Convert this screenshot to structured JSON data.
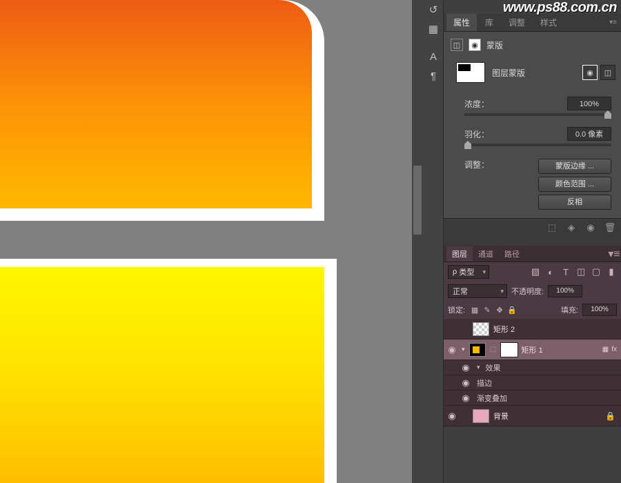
{
  "watermark": "www.ps88.com.cn",
  "toolbar": {
    "text_icon": "A",
    "pilcrow_icon": "¶"
  },
  "properties_panel": {
    "tabs": [
      "属性",
      "库",
      "调整",
      "样式"
    ],
    "title": "蒙版",
    "mask_type_label": "图层蒙版",
    "density_label": "浓度：",
    "density_value": "100%",
    "feather_label": "羽化：",
    "feather_value": "0.0 像素",
    "adjust_label": "调整：",
    "buttons": {
      "mask_edge": "蒙版边缘 ...",
      "color_range": "颜色范围 ...",
      "invert": "反相"
    }
  },
  "layers_panel": {
    "tabs": [
      "图层",
      "通道",
      "路径"
    ],
    "kind_label": "类型",
    "blend_mode": "正常",
    "opacity_label": "不透明度:",
    "opacity_value": "100%",
    "lock_label": "锁定:",
    "fill_label": "填充:",
    "fill_value": "100%",
    "layers": {
      "rect2": "矩形 2",
      "rect1": "矩形 1",
      "effects": "效果",
      "stroke": "描边",
      "gradient_overlay": "渐变叠加",
      "background": "背景"
    },
    "fx_label": "fx",
    "search_placeholder": "ρ"
  }
}
